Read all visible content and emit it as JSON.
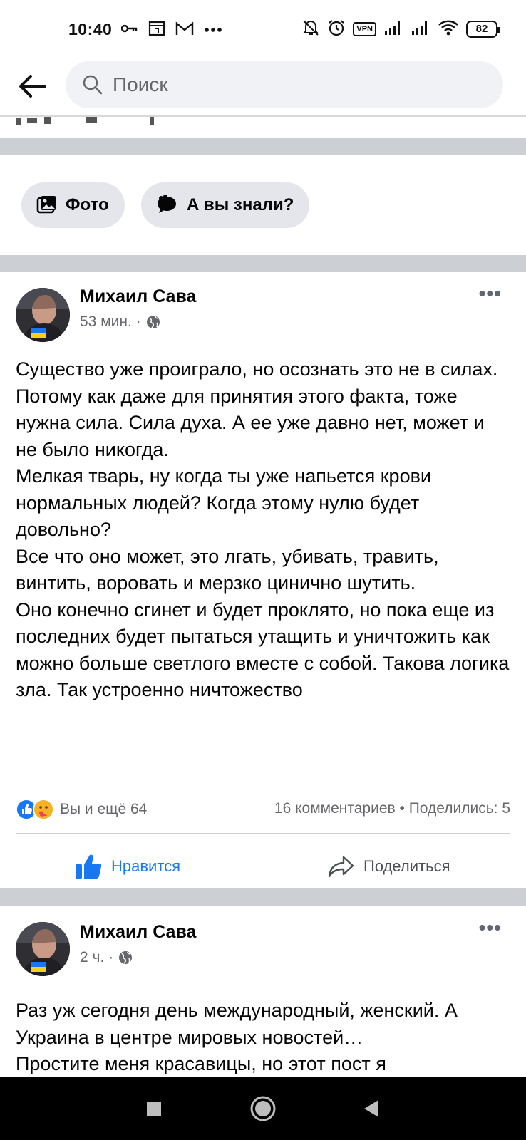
{
  "status_bar": {
    "time": "10:40",
    "battery": "82",
    "vpn": "VPN",
    "icons": [
      "key-icon",
      "square-icon",
      "gmail-icon",
      "dots-icon",
      "mute-icon",
      "alarm-icon",
      "vpn-icon",
      "signal-icon",
      "signal-icon",
      "wifi-icon",
      "battery-icon"
    ]
  },
  "search": {
    "placeholder": "Поиск"
  },
  "chips": [
    {
      "label": "Фото",
      "icon": "photo-icon"
    },
    {
      "label": "А вы знали?",
      "icon": "speech-bubble-icon"
    }
  ],
  "posts": [
    {
      "author": "Михаил Сава",
      "time": "53 мин.",
      "privacy_icon": "globe-icon",
      "text": "Существо уже проиграло, но осознать это не в силах.\nПотому как даже для принятия этого факта, тоже нужна сила. Сила духа. А ее уже давно нет, может и не было никогда.\nМелкая тварь, ну когда ты уже напьется крови нормальных людей? Когда этому нулю будет довольно?\nВсе что оно может, это лгать, убивать, травить, винтить, воровать и мерзко цинично шутить.\nОно конечно сгинет и будет проклято, но пока еще из последних будет пытаться утащить и уничтожить как можно больше светлого вместе с собой. Такова логика зла. Так устроенно ничтожество",
      "reactions_text": "Вы и ещё 64",
      "stats_text": "16 комментариев • Поделились: 5",
      "like_label": "Нравится",
      "share_label": "Поделиться"
    },
    {
      "author": "Михаил Сава",
      "time": "2 ч.",
      "privacy_icon": "globe-icon",
      "text": "Раз уж сегодня день международный, женский. А Украина в центре мировых новостей…\nПростите меня красавицы, но этот пост я"
    }
  ],
  "colors": {
    "accent": "#1877f2",
    "separator": "#ccd0d5",
    "secondary_text": "#65676b",
    "chip_bg": "#e4e6eb"
  }
}
